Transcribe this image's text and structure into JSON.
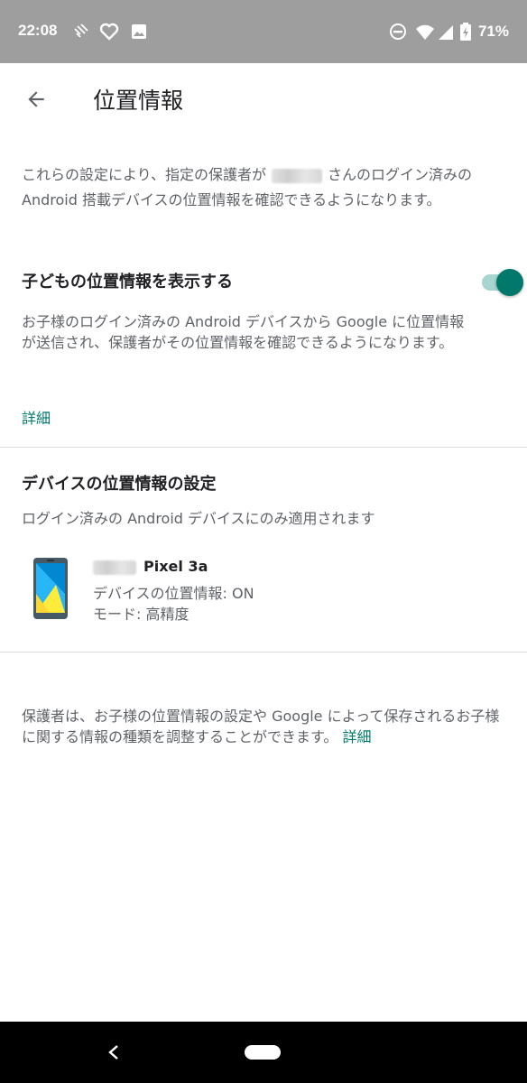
{
  "status_bar": {
    "time": "22:08",
    "battery": "71%",
    "icons": [
      "signal-wave-icon",
      "heart-icon",
      "image-icon",
      "do-not-disturb-icon",
      "wifi-icon",
      "cell-signal-icon",
      "battery-charging-icon"
    ]
  },
  "app_bar": {
    "title": "位置情報",
    "back_icon": "arrow-back-icon"
  },
  "intro": {
    "text_before": "これらの設定により、指定の保護者が",
    "text_after": "さんのログイン済みの Android 搭載デバイスの位置情報を確認できるようになります。"
  },
  "show_location": {
    "title": "子どもの位置情報を表示する",
    "enabled": true,
    "accent_color": "#00796b",
    "description": "お子様のログイン済みの Android デバイスから Google に位置情報が送信され、保護者がその位置情報を確認できるようになります。",
    "learn_more": "詳細"
  },
  "device_settings": {
    "title": "デバイスの位置情報の設定",
    "subtitle": "ログイン済みの Android デバイスにのみ適用されます",
    "device": {
      "name": "Pixel 3a",
      "location_status": "デバイスの位置情報: ON",
      "mode": "モード: 高精度",
      "icon": "phone-icon"
    }
  },
  "footer": {
    "text": "保護者は、お子様の位置情報の設定や Google によって保存されるお子様に関する情報の種類を調整することができます。",
    "learn_more": "詳細"
  },
  "nav_bar": {
    "back_icon": "nav-back-icon",
    "home_icon": "nav-home-pill"
  }
}
